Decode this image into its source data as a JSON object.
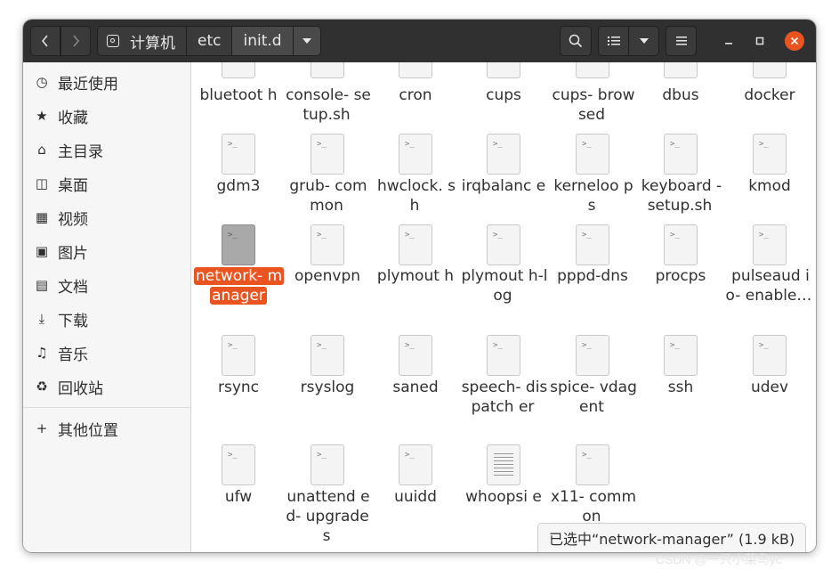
{
  "header": {
    "breadcrumbs": [
      "计算机",
      "etc",
      "init.d"
    ]
  },
  "sidebar": {
    "items": [
      {
        "label": "最近使用",
        "icon": "clock-icon"
      },
      {
        "label": "收藏",
        "icon": "star-icon"
      },
      {
        "label": "主目录",
        "icon": "home-icon"
      },
      {
        "label": "桌面",
        "icon": "desktop-icon"
      },
      {
        "label": "视频",
        "icon": "video-icon"
      },
      {
        "label": "图片",
        "icon": "image-icon"
      },
      {
        "label": "文档",
        "icon": "document-icon"
      },
      {
        "label": "下载",
        "icon": "download-icon"
      },
      {
        "label": "音乐",
        "icon": "music-icon"
      },
      {
        "label": "回收站",
        "icon": "trash-icon"
      }
    ],
    "other_locations": "其他位置"
  },
  "files": [
    {
      "name": "bluetooth",
      "display": "bluetoot h"
    },
    {
      "name": "console-setup.sh",
      "display": "console- setup.sh"
    },
    {
      "name": "cron",
      "display": "cron"
    },
    {
      "name": "cups",
      "display": "cups"
    },
    {
      "name": "cups-browsed",
      "display": "cups- browsed"
    },
    {
      "name": "dbus",
      "display": "dbus"
    },
    {
      "name": "docker",
      "display": "docker"
    },
    {
      "name": "gdm3",
      "display": "gdm3"
    },
    {
      "name": "grub-common",
      "display": "grub- common"
    },
    {
      "name": "hwclock.sh",
      "display": "hwclock. sh"
    },
    {
      "name": "irqbalance",
      "display": "irqbalanc e"
    },
    {
      "name": "kerneloops",
      "display": "kerneloo ps"
    },
    {
      "name": "keyboard-setup.sh",
      "display": "keyboard -setup.sh"
    },
    {
      "name": "kmod",
      "display": "kmod"
    },
    {
      "name": "network-manager",
      "display": "network- manager",
      "selected": true
    },
    {
      "name": "openvpn",
      "display": "openvpn"
    },
    {
      "name": "plymouth",
      "display": "plymout h"
    },
    {
      "name": "plymouth-log",
      "display": "plymout h-log"
    },
    {
      "name": "pppd-dns",
      "display": "pppd-dns"
    },
    {
      "name": "procps",
      "display": "procps"
    },
    {
      "name": "pulseaudio-enable",
      "display": "pulseaud io- enable…"
    },
    {
      "name": "rsync",
      "display": "rsync"
    },
    {
      "name": "rsyslog",
      "display": "rsyslog"
    },
    {
      "name": "saned",
      "display": "saned"
    },
    {
      "name": "speech-dispatcher",
      "display": "speech- dispatch er"
    },
    {
      "name": "spice-vdagent",
      "display": "spice- vdagent"
    },
    {
      "name": "ssh",
      "display": "ssh"
    },
    {
      "name": "udev",
      "display": "udev"
    },
    {
      "name": "ufw",
      "display": "ufw"
    },
    {
      "name": "unattended-upgrades",
      "display": "unattend ed- upgrades"
    },
    {
      "name": "uuidd",
      "display": "uuidd"
    },
    {
      "name": "whoopsie",
      "display": "whoopsi e",
      "text_icon": true
    },
    {
      "name": "x11-common",
      "display": "x11- common"
    }
  ],
  "status": "已选中“network-manager” (1.9 kB)",
  "watermark": "CSDN @一只小菜鸟yc",
  "colors": {
    "header_bg": "#303030",
    "accent": "#e95420",
    "sidebar_bg": "#f6f6f6"
  }
}
